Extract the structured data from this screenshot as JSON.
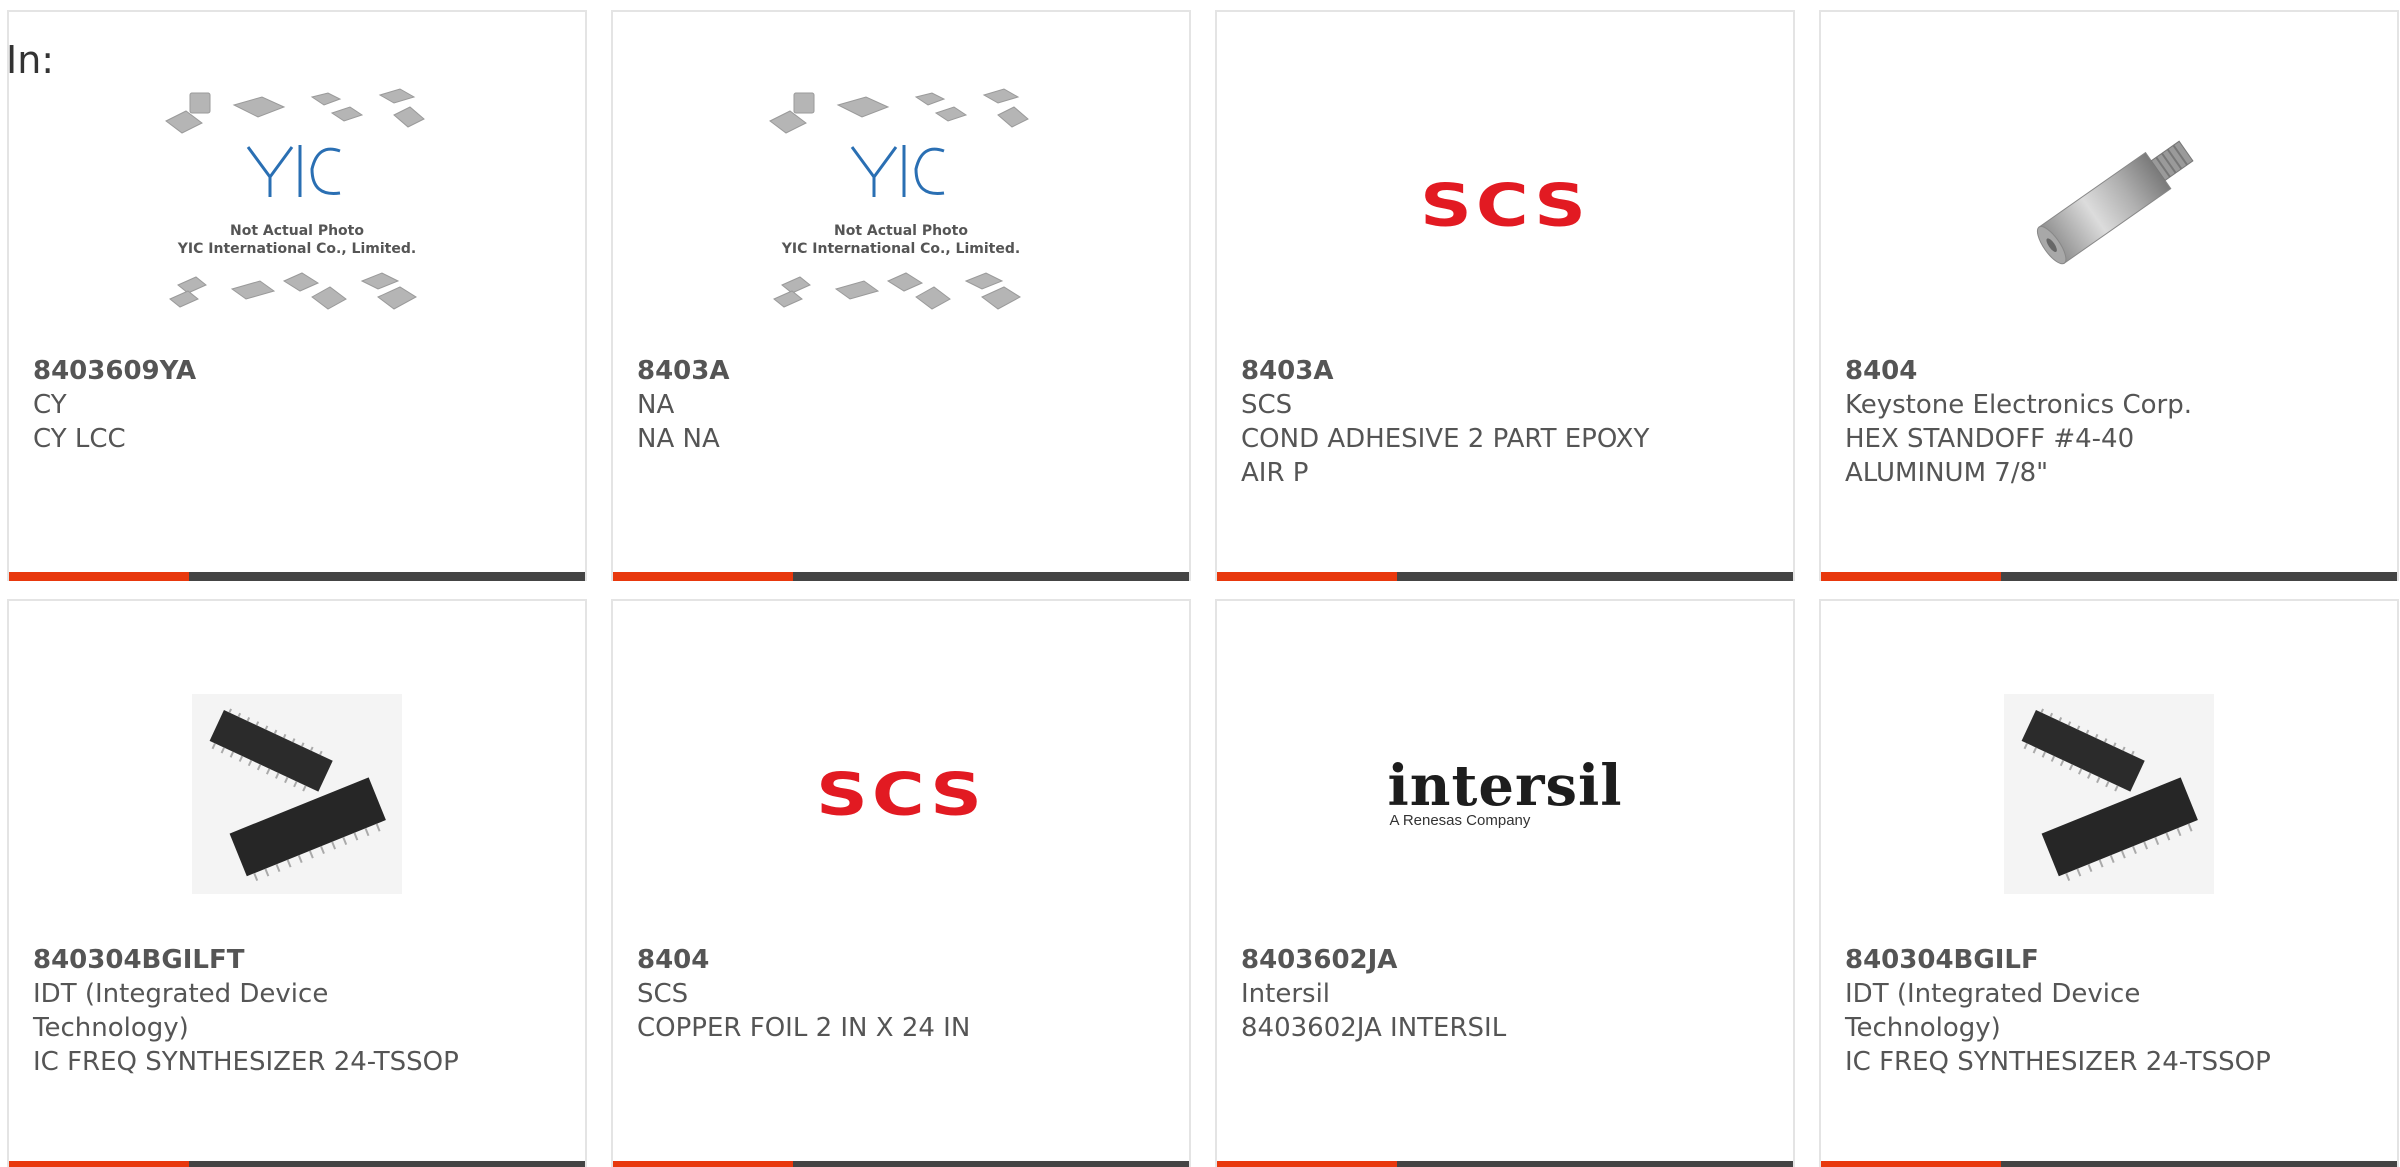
{
  "filter": {
    "label": "In:"
  },
  "accent_color": "#e8380d",
  "bar_color": "#444444",
  "products": [
    {
      "part": "8403609YA",
      "manufacturer": "CY",
      "description": "CY LCC",
      "image": "yic-placeholder-icon"
    },
    {
      "part": "8403A",
      "manufacturer": "NA",
      "description": "NA NA",
      "image": "yic-placeholder-icon"
    },
    {
      "part": "8403A",
      "manufacturer": "SCS",
      "description": "COND ADHESIVE 2 PART EPOXY AIR P",
      "image": "scs-logo",
      "logo_text": "SCS"
    },
    {
      "part": "8404",
      "manufacturer": "Keystone Electronics Corp.",
      "description": "HEX STANDOFF #4-40 ALUMINUM 7/8\"",
      "image": "hex-standoff-photo"
    },
    {
      "part": "840304BGILFT",
      "manufacturer": "IDT (Integrated Device Technology)",
      "description": "IC FREQ SYNTHESIZER 24-TSSOP",
      "image": "tssop-chip-photo"
    },
    {
      "part": "8404",
      "manufacturer": "SCS",
      "description": "COPPER FOIL 2 IN X 24 IN",
      "image": "scs-logo",
      "logo_text": "SCS"
    },
    {
      "part": "8403602JA",
      "manufacturer": "Intersil",
      "description": "8403602JA INTERSIL",
      "image": "intersil-logo",
      "logo_text": "intersil",
      "logo_sub": "A Renesas Company"
    },
    {
      "part": "840304BGILF",
      "manufacturer": "IDT (Integrated Device Technology)",
      "description": "IC FREQ SYNTHESIZER 24-TSSOP",
      "image": "tssop-chip-photo"
    }
  ],
  "yic_placeholder": {
    "line1": "Not Actual Photo",
    "line2": "YIC International Co., Limited.",
    "brand": "YIC"
  }
}
